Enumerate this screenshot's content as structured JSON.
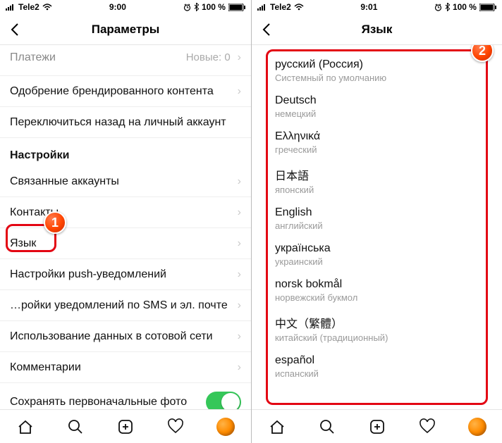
{
  "left": {
    "status": {
      "carrier": "Tele2",
      "time": "9:00",
      "battery": "100 %"
    },
    "title": "Параметры",
    "rows": {
      "payments": {
        "label": "Платежи",
        "sub": "Новые: 0"
      },
      "branded": "Одобрение брендированного контента",
      "switch_back": "Переключиться назад на личный аккаунт",
      "section": "Настройки",
      "linked": "Связанные аккаунты",
      "contacts": "Контакты",
      "language": "Язык",
      "push": "Настройки push-уведомлений",
      "sms_email": "…ройки уведомлений по SMS и эл. почте",
      "cellular": "Использование данных в сотовой сети",
      "comments": "Комментарии",
      "save_original": "Сохранять первоначальные фото"
    },
    "badge": "1"
  },
  "right": {
    "status": {
      "carrier": "Tele2",
      "time": "9:01",
      "battery": "100 %"
    },
    "title": "Язык",
    "languages": [
      {
        "name": "русский (Россия)",
        "sub": "Системный по умолчанию"
      },
      {
        "name": "Deutsch",
        "sub": "немецкий"
      },
      {
        "name": "Ελληνικά",
        "sub": "греческий"
      },
      {
        "name": "日本語",
        "sub": "японский"
      },
      {
        "name": "English",
        "sub": "английский"
      },
      {
        "name": "українська",
        "sub": "украинский"
      },
      {
        "name": "norsk bokmål",
        "sub": "норвежский букмол"
      },
      {
        "name": "中文（繁體）",
        "sub": "китайский (традиционный)"
      },
      {
        "name": "español",
        "sub": "испанский"
      }
    ],
    "badge": "2"
  }
}
